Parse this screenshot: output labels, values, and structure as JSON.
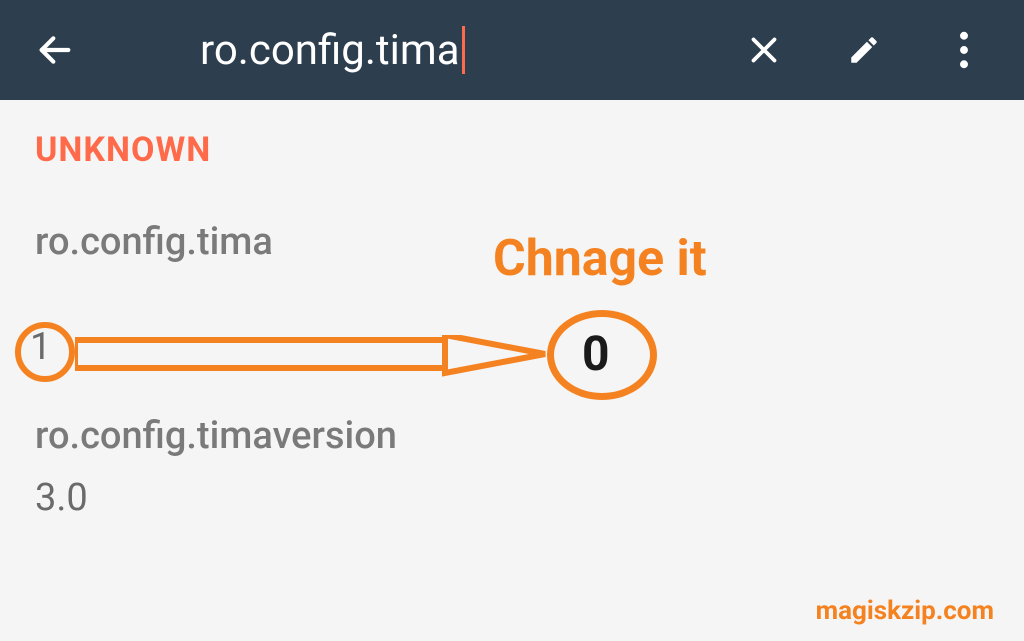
{
  "header": {
    "search_text": "ro.config.tima"
  },
  "section": {
    "title": "UNKNOWN"
  },
  "properties": [
    {
      "key": "ro.config.tima",
      "value": "1"
    },
    {
      "key": "ro.config.timaversion",
      "value": "3.0"
    }
  ],
  "annotation": {
    "change_label": "Chnage it",
    "target_value": "0"
  },
  "watermark": "magiskzip.com"
}
